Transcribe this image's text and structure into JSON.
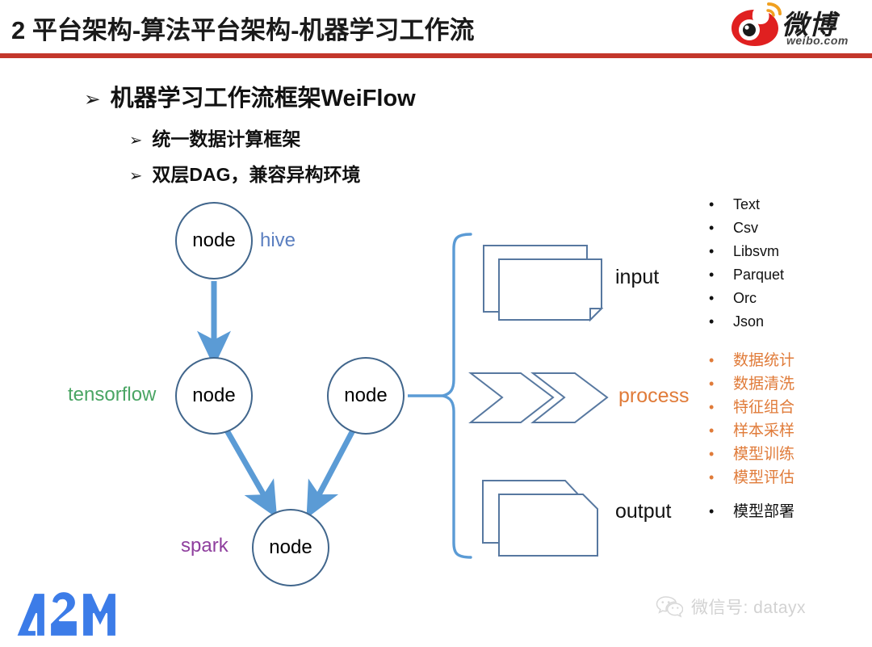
{
  "header": {
    "title": "2 平台架构-算法平台架构-机器学习工作流",
    "rule_color": "#c3372b",
    "logo": {
      "name": "weibo-logo",
      "text": "微博",
      "subtext": "weibo.com",
      "color": "#e02020"
    }
  },
  "bullets": {
    "arrow_glyph": "➢",
    "level1": "机器学习工作流框架WeiFlow",
    "level2": [
      "统一数据计算框架",
      "双层DAG，兼容异构环境"
    ]
  },
  "diagram": {
    "node_label": "node",
    "node_stroke": "#41668c",
    "arrow_color": "#5b9bd5",
    "brace_color": "#5b9bd5",
    "shape_stroke": "#5778a0",
    "nodes": [
      {
        "id": "node-top",
        "label": "node"
      },
      {
        "id": "node-mid-left",
        "label": "node"
      },
      {
        "id": "node-mid-right",
        "label": "node"
      },
      {
        "id": "node-bottom",
        "label": "node"
      }
    ],
    "engine_labels": [
      {
        "id": "hive",
        "text": "hive",
        "color": "#5b7fc0"
      },
      {
        "id": "tensorflow",
        "text": "tensorflow",
        "color": "#4aa564"
      },
      {
        "id": "spark",
        "text": "spark",
        "color": "#8f3f9e"
      }
    ],
    "stages": [
      {
        "id": "input",
        "label": "input",
        "label_color": "#111111",
        "icon": "documents-icon",
        "items": [
          "Text",
          "Csv",
          "Libsvm",
          "Parquet",
          "Orc",
          "Json"
        ],
        "items_color": "#111111"
      },
      {
        "id": "process",
        "label": "process",
        "label_color": "#e07b39",
        "icon": "chevrons-icon",
        "items": [
          "数据统计",
          "数据清洗",
          "特征组合",
          "样本采样",
          "模型训练",
          "模型评估"
        ],
        "items_color": "#e07b39"
      },
      {
        "id": "output",
        "label": "output",
        "label_color": "#111111",
        "icon": "documents-cut-corner-icon",
        "items": [
          "模型部署"
        ],
        "items_color": "#111111"
      }
    ],
    "bullet_dot": "•"
  },
  "footer": {
    "brand_logo": "a2m-logo",
    "brand_text": "A2M",
    "brand_color": "#3c7ce8",
    "wechat": {
      "icon": "wechat-icon",
      "text": "微信号: datayx",
      "color": "#d2d2d2"
    }
  }
}
